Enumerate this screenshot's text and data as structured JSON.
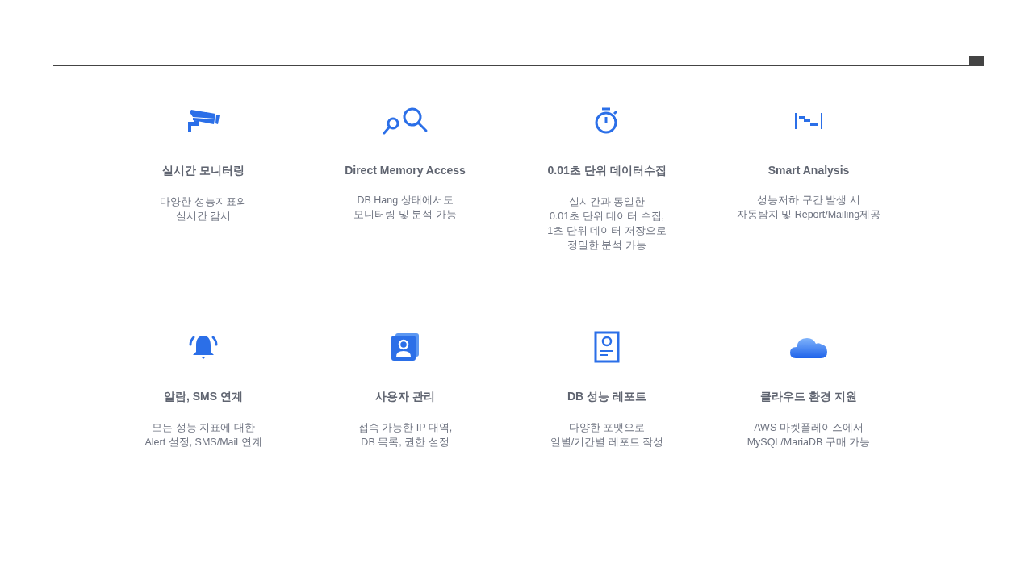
{
  "features": [
    {
      "title": "실시간 모니터링",
      "lines": [
        "다양한 성능지표의",
        "실시간 감시"
      ]
    },
    {
      "title": "Direct Memory Access",
      "lines": [
        "DB Hang 상태에서도",
        "모니터링 및 분석 가능"
      ]
    },
    {
      "title": "0.01초 단위 데이터수집",
      "lines": [
        "실시간과 동일한",
        "0.01초 단위 데이터 수집,",
        "1초 단위 데이터 저장으로",
        "정밀한 분석 가능"
      ]
    },
    {
      "title": "Smart Analysis",
      "lines": [
        "성능저하 구간 발생 시",
        "자동탐지 및 Report/Mailing제공"
      ]
    },
    {
      "title": "알람, SMS 연계",
      "lines": [
        "모든 성능 지표에 대한",
        "Alert 설정, SMS/Mail 연계"
      ]
    },
    {
      "title": "사용자 관리",
      "lines": [
        "접속 가능한 IP 대역,",
        "DB 목록, 권한 설정"
      ]
    },
    {
      "title": "DB 성능 레포트",
      "lines": [
        "다양한 포맷으로",
        "일별/기간별 레포트 작성"
      ]
    },
    {
      "title": "클라우드 환경 지원",
      "lines": [
        "AWS 마켓플레이스에서",
        "MySQL/MariaDB 구매 가능"
      ]
    }
  ]
}
